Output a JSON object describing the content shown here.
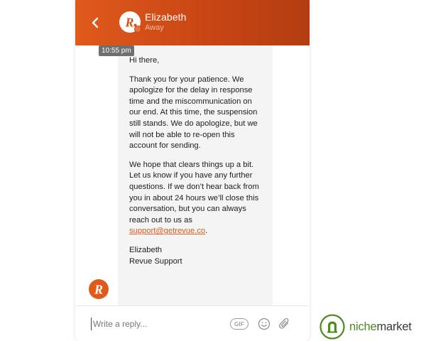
{
  "header": {
    "agent_name": "Elizabeth",
    "agent_status": "Away",
    "avatar_letter": "R.",
    "back_icon": "chevron-left-icon"
  },
  "conversation": {
    "timestamp": "10:55 pm",
    "message": {
      "greeting": "Hi there,",
      "paragraph_1": "Thank you for your patience. We apologize for the delay in response time and the miscommunication on our end. At this time, the suspension still stands. We do apologize, but we will not be able to re-open this account for sending.",
      "paragraph_2_text": "We hope that clears things up a bit. Let us know if you have any further questions. If we don’t hear back from you in about 24 hours we’ll close this conversation, but you can always reach out to us as",
      "email_link": "support@getrevue.co",
      "paragraph_2_end": ".",
      "signature_name": "Elizabeth",
      "signature_team": "Revue Support"
    },
    "sender_avatar_letter": "R"
  },
  "composer": {
    "placeholder": "Write a reply...",
    "gif_label": "GIF",
    "emoji_icon": "smiley-icon",
    "attach_icon": "paperclip-icon"
  },
  "brand": {
    "niche": "niche",
    "market": "market"
  },
  "colors": {
    "header_start": "#e05a1c",
    "header_end": "#b33d12",
    "link": "#e05a1c",
    "bubble_bg": "#f4f4f4",
    "brand_green": "#4f8a1e"
  }
}
